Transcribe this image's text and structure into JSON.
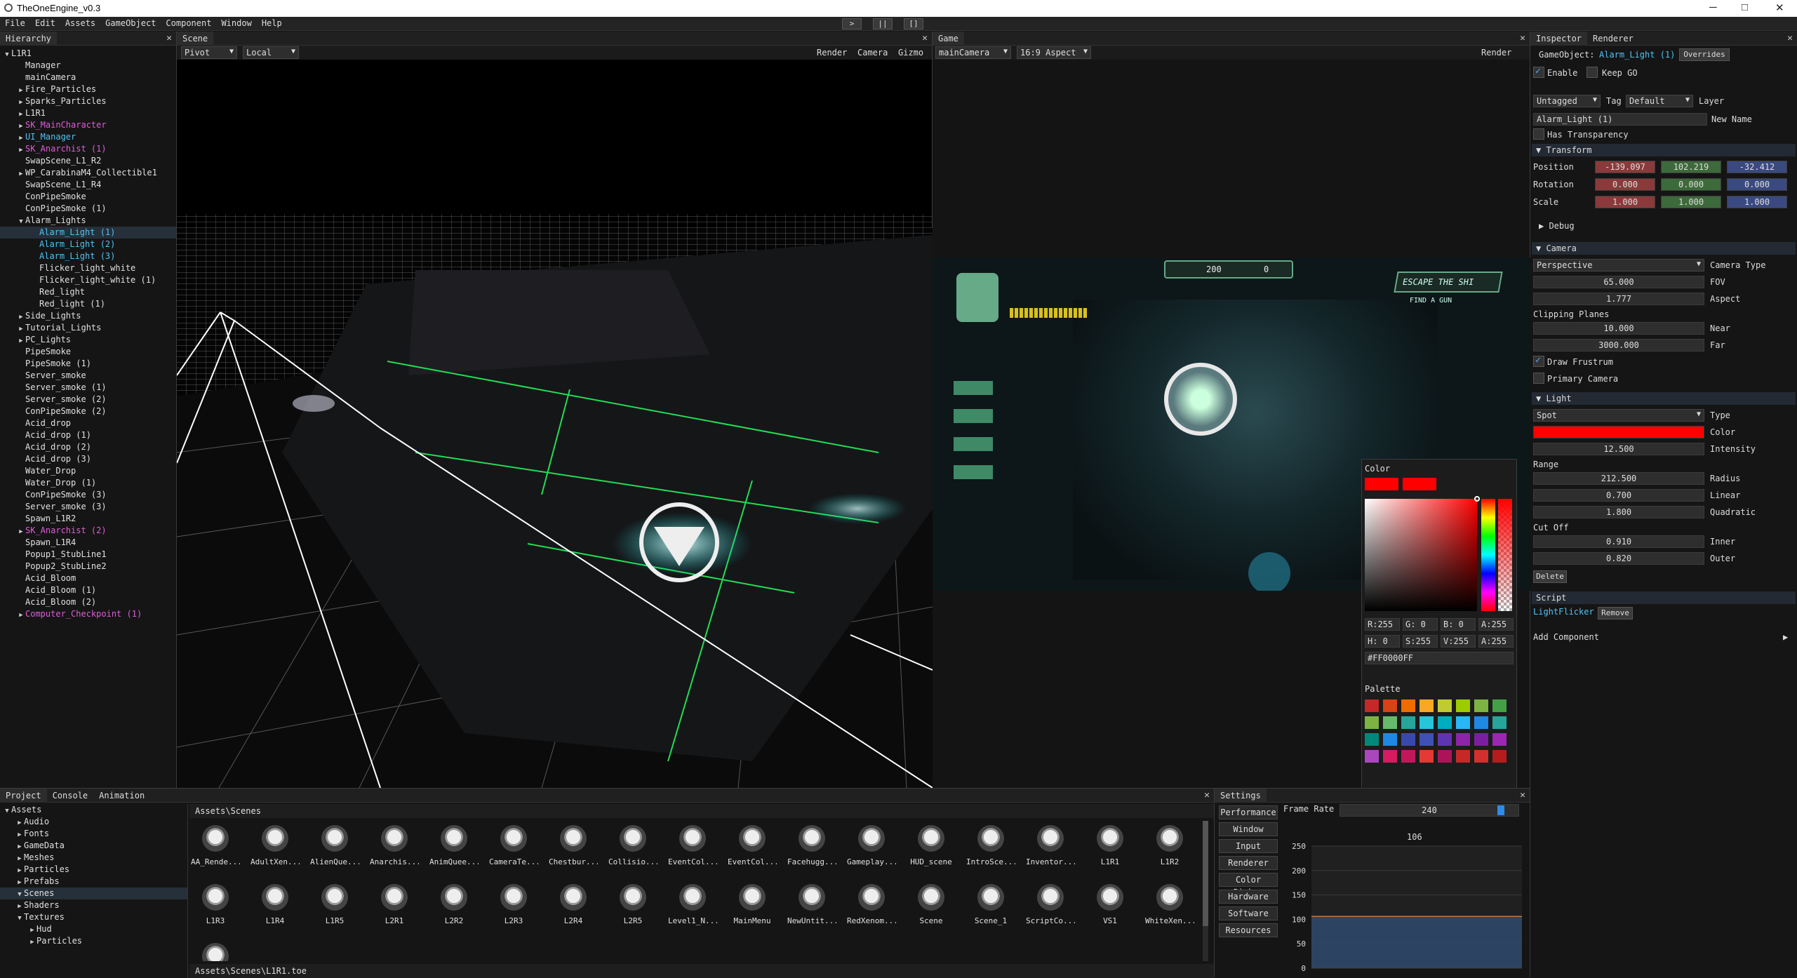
{
  "window": {
    "title": "TheOneEngine_v0.3",
    "minimize": "─",
    "maximize": "□",
    "close": "✕"
  },
  "menu": [
    "File",
    "Edit",
    "Assets",
    "GameObject",
    "Component",
    "Window",
    "Help"
  ],
  "play_controls": {
    "play": ">",
    "pause": "||",
    "stop": "[]"
  },
  "hierarchy": {
    "tab": "Hierarchy",
    "items": [
      {
        "label": "L1R1",
        "depth": 0,
        "arrow": "▼",
        "color": "#e0e0e0"
      },
      {
        "label": "Manager",
        "depth": 1,
        "arrow": "",
        "color": "#e0e0e0"
      },
      {
        "label": "mainCamera",
        "depth": 1,
        "arrow": "",
        "color": "#e0e0e0"
      },
      {
        "label": "Fire_Particles",
        "depth": 1,
        "arrow": "▶",
        "color": "#e0e0e0"
      },
      {
        "label": "Sparks_Particles",
        "depth": 1,
        "arrow": "▶",
        "color": "#e0e0e0"
      },
      {
        "label": "L1R1",
        "depth": 1,
        "arrow": "▶",
        "color": "#e0e0e0"
      },
      {
        "label": "SK_MainCharacter",
        "depth": 1,
        "arrow": "▶",
        "color": "#e05cd8"
      },
      {
        "label": "UI_Manager",
        "depth": 1,
        "arrow": "▶",
        "color": "#4fc3f7"
      },
      {
        "label": "SK_Anarchist (1)",
        "depth": 1,
        "arrow": "▶",
        "color": "#e05cd8"
      },
      {
        "label": "SwapScene_L1_R2",
        "depth": 1,
        "arrow": "",
        "color": "#e0e0e0"
      },
      {
        "label": "WP_CarabinaM4_Collectible1",
        "depth": 1,
        "arrow": "▶",
        "color": "#e0e0e0"
      },
      {
        "label": "SwapScene_L1_R4",
        "depth": 1,
        "arrow": "",
        "color": "#e0e0e0"
      },
      {
        "label": "ConPipeSmoke",
        "depth": 1,
        "arrow": "",
        "color": "#e0e0e0"
      },
      {
        "label": "ConPipeSmoke (1)",
        "depth": 1,
        "arrow": "",
        "color": "#e0e0e0"
      },
      {
        "label": "Alarm_Lights",
        "depth": 1,
        "arrow": "▼",
        "color": "#e0e0e0"
      },
      {
        "label": "Alarm_Light (1)",
        "depth": 2,
        "arrow": "",
        "color": "#4fc3f7",
        "selected": true
      },
      {
        "label": "Alarm_Light (2)",
        "depth": 2,
        "arrow": "",
        "color": "#4fc3f7"
      },
      {
        "label": "Alarm_Light (3)",
        "depth": 2,
        "arrow": "",
        "color": "#4fc3f7"
      },
      {
        "label": "Flicker_light_white",
        "depth": 2,
        "arrow": "",
        "color": "#e0e0e0"
      },
      {
        "label": "Flicker_light_white (1)",
        "depth": 2,
        "arrow": "",
        "color": "#e0e0e0"
      },
      {
        "label": "Red_light",
        "depth": 2,
        "arrow": "",
        "color": "#e0e0e0"
      },
      {
        "label": "Red_light (1)",
        "depth": 2,
        "arrow": "",
        "color": "#e0e0e0"
      },
      {
        "label": "Side_Lights",
        "depth": 1,
        "arrow": "▶",
        "color": "#e0e0e0"
      },
      {
        "label": "Tutorial_Lights",
        "depth": 1,
        "arrow": "▶",
        "color": "#e0e0e0"
      },
      {
        "label": "PC_Lights",
        "depth": 1,
        "arrow": "▶",
        "color": "#e0e0e0"
      },
      {
        "label": "PipeSmoke",
        "depth": 1,
        "arrow": "",
        "color": "#e0e0e0"
      },
      {
        "label": "PipeSmoke (1)",
        "depth": 1,
        "arrow": "",
        "color": "#e0e0e0"
      },
      {
        "label": "Server_smoke",
        "depth": 1,
        "arrow": "",
        "color": "#e0e0e0"
      },
      {
        "label": "Server_smoke (1)",
        "depth": 1,
        "arrow": "",
        "color": "#e0e0e0"
      },
      {
        "label": "Server_smoke (2)",
        "depth": 1,
        "arrow": "",
        "color": "#e0e0e0"
      },
      {
        "label": "ConPipeSmoke (2)",
        "depth": 1,
        "arrow": "",
        "color": "#e0e0e0"
      },
      {
        "label": "Acid_drop",
        "depth": 1,
        "arrow": "",
        "color": "#e0e0e0"
      },
      {
        "label": "Acid_drop (1)",
        "depth": 1,
        "arrow": "",
        "color": "#e0e0e0"
      },
      {
        "label": "Acid_drop (2)",
        "depth": 1,
        "arrow": "",
        "color": "#e0e0e0"
      },
      {
        "label": "Acid_drop (3)",
        "depth": 1,
        "arrow": "",
        "color": "#e0e0e0"
      },
      {
        "label": "Water_Drop",
        "depth": 1,
        "arrow": "",
        "color": "#e0e0e0"
      },
      {
        "label": "Water_Drop (1)",
        "depth": 1,
        "arrow": "",
        "color": "#e0e0e0"
      },
      {
        "label": "ConPipeSmoke (3)",
        "depth": 1,
        "arrow": "",
        "color": "#e0e0e0"
      },
      {
        "label": "Server_smoke (3)",
        "depth": 1,
        "arrow": "",
        "color": "#e0e0e0"
      },
      {
        "label": "Spawn_L1R2",
        "depth": 1,
        "arrow": "",
        "color": "#e0e0e0"
      },
      {
        "label": "SK_Anarchist (2)",
        "depth": 1,
        "arrow": "▶",
        "color": "#e05cd8"
      },
      {
        "label": "Spawn_L1R4",
        "depth": 1,
        "arrow": "",
        "color": "#e0e0e0"
      },
      {
        "label": "Popup1_StubLine1",
        "depth": 1,
        "arrow": "",
        "color": "#e0e0e0"
      },
      {
        "label": "Popup2_StubLine2",
        "depth": 1,
        "arrow": "",
        "color": "#e0e0e0"
      },
      {
        "label": "Acid_Bloom",
        "depth": 1,
        "arrow": "",
        "color": "#e0e0e0"
      },
      {
        "label": "Acid_Bloom (1)",
        "depth": 1,
        "arrow": "",
        "color": "#e0e0e0"
      },
      {
        "label": "Acid_Bloom (2)",
        "depth": 1,
        "arrow": "",
        "color": "#e0e0e0"
      },
      {
        "label": "Computer_Checkpoint (1)",
        "depth": 1,
        "arrow": "▶",
        "color": "#e05cd8"
      }
    ]
  },
  "scene": {
    "tab": "Scene",
    "pivot": "Pivot",
    "local": "Local",
    "render": "Render",
    "camera": "Camera",
    "gizmo": "Gizmo"
  },
  "game": {
    "tab": "Game",
    "camera": "mainCamera",
    "aspect": "16:9 Aspect",
    "render": "Render",
    "hud_score": "200",
    "hud_count": "0",
    "hud_objective": "ESCAPE THE SHI",
    "hud_sub": "FIND A GUN"
  },
  "color_picker": {
    "title": "Color",
    "r": "R:255",
    "g": "G: 0",
    "b": "B: 0",
    "a": "A:255",
    "h": "H: 0",
    "s": "S:255",
    "v": "V:255",
    "a2": "A:255",
    "hex": "#FF0000FF",
    "palette_label": "Palette",
    "palette": [
      "#c62828",
      "#d84315",
      "#ef6c00",
      "#f9a825",
      "#c0ca33",
      "#9ccc00",
      "#7cb342",
      "#43a047",
      "#7cb342",
      "#66bb6a",
      "#26a69a",
      "#26c6da",
      "#00acc1",
      "#29b6f6",
      "#1e88e5",
      "#26a69a",
      "#00897b",
      "#1e88e5",
      "#3949ab",
      "#3f51b5",
      "#5e35b1",
      "#8e24aa",
      "#7b1fa2",
      "#9c27b0",
      "#ab47bc",
      "#d81b60",
      "#c2185b",
      "#e53935",
      "#ad1457",
      "#c62828",
      "#d32f2f",
      "#b71c1c"
    ]
  },
  "inspector": {
    "tab1": "Inspector",
    "tab2": "Renderer",
    "go_label": "GameObject:",
    "go_name": "Alarm_Light (1)",
    "overrides": "Overrides",
    "enable": "Enable",
    "keep_go": "Keep GO",
    "tag_value": "Untagged",
    "tag_label": "Tag",
    "layer_value": "Default",
    "layer_label": "Layer",
    "name_value": "Alarm_Light (1)",
    "new_name": "New Name",
    "has_transparency": "Has Transparency",
    "transform": {
      "title": "Transform",
      "position_label": "Position",
      "rotation_label": "Rotation",
      "scale_label": "Scale",
      "position": [
        "-139.097",
        "102.219",
        "-32.412"
      ],
      "rotation": [
        "0.000",
        "0.000",
        "0.000"
      ],
      "scale": [
        "1.000",
        "1.000",
        "1.000"
      ]
    },
    "debug": "Debug",
    "camera": {
      "title": "Camera",
      "type_value": "Perspective",
      "type_label": "Camera Type",
      "fov": "65.000",
      "fov_label": "FOV",
      "aspect": "1.777",
      "aspect_label": "Aspect",
      "clipping": "Clipping Planes",
      "near": "10.000",
      "near_label": "Near",
      "far": "3000.000",
      "far_label": "Far",
      "draw_frustum": "Draw Frustrum",
      "primary": "Primary Camera"
    },
    "light": {
      "title": "Light",
      "type_value": "Spot",
      "type_label": "Type",
      "color_label": "Color",
      "color": "#ff0000",
      "intensity": "12.500",
      "intensity_label": "Intensity",
      "range": "Range",
      "radius": "212.500",
      "radius_label": "Radius",
      "linear": "0.700",
      "linear_label": "Linear",
      "quadratic": "1.800",
      "quadratic_label": "Quadratic",
      "cutoff": "Cut Off",
      "inner": "0.910",
      "inner_label": "Inner",
      "outer": "0.820",
      "outer_label": "Outer",
      "delete": "Delete"
    },
    "script": {
      "title": "Script",
      "name": "LightFlicker",
      "remove": "Remove"
    },
    "add_component": "Add Component"
  },
  "project": {
    "tabs": [
      "Project",
      "Console",
      "Animation"
    ],
    "tree": [
      {
        "label": "Assets",
        "depth": 0,
        "arrow": "▼"
      },
      {
        "label": "Audio",
        "depth": 1,
        "arrow": "▶"
      },
      {
        "label": "Fonts",
        "depth": 1,
        "arrow": "▶"
      },
      {
        "label": "GameData",
        "depth": 1,
        "arrow": "▶"
      },
      {
        "label": "Meshes",
        "depth": 1,
        "arrow": "▶"
      },
      {
        "label": "Particles",
        "depth": 1,
        "arrow": "▶"
      },
      {
        "label": "Prefabs",
        "depth": 1,
        "arrow": "▶"
      },
      {
        "label": "Scenes",
        "depth": 1,
        "arrow": "▼",
        "selected": true
      },
      {
        "label": "Shaders",
        "depth": 1,
        "arrow": "▶"
      },
      {
        "label": "Textures",
        "depth": 1,
        "arrow": "▼"
      },
      {
        "label": "Hud",
        "depth": 2,
        "arrow": "▶"
      },
      {
        "label": "Particles",
        "depth": 2,
        "arrow": "▶"
      }
    ],
    "path": "Assets\\Scenes",
    "footer": "Assets\\Scenes\\L1R1.toe",
    "assets": [
      "AA_Rende...",
      "AdultXen...",
      "AlienQue...",
      "Anarchis...",
      "AnimQuee...",
      "CameraTe...",
      "Chestbur...",
      "Collisio...",
      "EventCol...",
      "EventCol...",
      "Facehugg...",
      "Gameplay...",
      "HUD_scene",
      "IntroSce...",
      "Inventor...",
      "L1R1",
      "L1R2",
      "L1R3",
      "L1R4",
      "L1R5",
      "L2R1",
      "L2R2",
      "L2R3",
      "L2R4",
      "L2R5",
      "Level1_N...",
      "MainMenu",
      "NewUntit...",
      "RedXenom...",
      "Scene",
      "Scene_1",
      "ScriptCo...",
      "VS1",
      "WhiteXen...",
      ""
    ]
  },
  "settings": {
    "tab": "Settings",
    "buttons": [
      "Performance",
      "Window",
      "Input",
      "Renderer",
      "Color Picker",
      "Hardware",
      "Software",
      "Resources"
    ],
    "frame_rate_label": "Frame Rate",
    "frame_rate": "240",
    "current": "106",
    "yticks": [
      "250",
      "200",
      "150",
      "100",
      "50",
      "0"
    ]
  },
  "chart_data": {
    "type": "area",
    "ylim": [
      0,
      250
    ],
    "series": [
      {
        "values": [
          106,
          106,
          106,
          106,
          106,
          106,
          106,
          106,
          106,
          106,
          106,
          106,
          106,
          106,
          106,
          106,
          106,
          106,
          106,
          106
        ]
      }
    ]
  },
  "colors": {
    "accent": "#4fc3f7",
    "prefab": "#e05cd8",
    "red": "#ff0000"
  }
}
